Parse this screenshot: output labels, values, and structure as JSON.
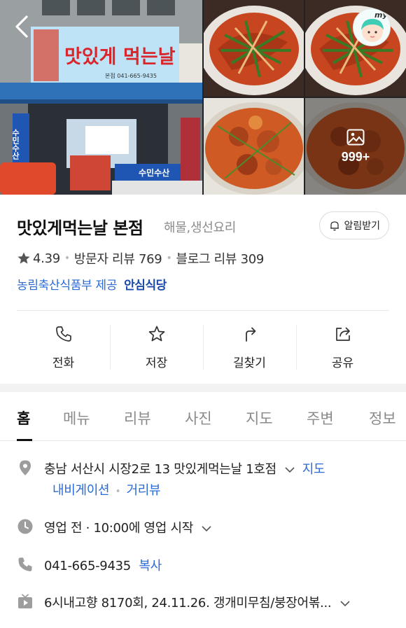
{
  "gallery": {
    "more_count": "999+",
    "storefront_sign": {
      "banner": "맛있게 먹는날",
      "banner_line": "본점 041-665-9435",
      "side_sign": "수민수산",
      "counter_sign": "수민수산"
    }
  },
  "place": {
    "name": "맛있게먹는날 본점",
    "category": "해물,생선요리",
    "alarm_label": "알림받기",
    "rating": "4.39",
    "visitor_review": "방문자 리뷰 769",
    "blog_review": "블로그 리뷰 309",
    "provider": "농림축산식품부 제공",
    "safe_badge": "안심식당"
  },
  "actions": [
    {
      "label": "전화",
      "icon": "phone-icon"
    },
    {
      "label": "저장",
      "icon": "star-icon"
    },
    {
      "label": "길찾기",
      "icon": "directions-icon"
    },
    {
      "label": "공유",
      "icon": "share-icon"
    }
  ],
  "tabs": [
    "홈",
    "메뉴",
    "리뷰",
    "사진",
    "지도",
    "주변",
    "정보"
  ],
  "details": {
    "address": "충남 서산시 시장2로 13 맛있게먹는날 1호점",
    "map_link": "지도",
    "navigation_link": "내비게이션",
    "street_view_link": "거리뷰",
    "hours": "영업 전 · 10:00에 영업 시작",
    "phone": "041-665-9435",
    "copy_label": "복사",
    "tv": "6시내고향 8170회, 24.11.26. 갱개미무침/붕장어볶..."
  },
  "colors": {
    "link": "#2a6bd6",
    "safe_badge": "#1d4aa8",
    "text": "#111111",
    "muted": "#8c8c8c"
  }
}
